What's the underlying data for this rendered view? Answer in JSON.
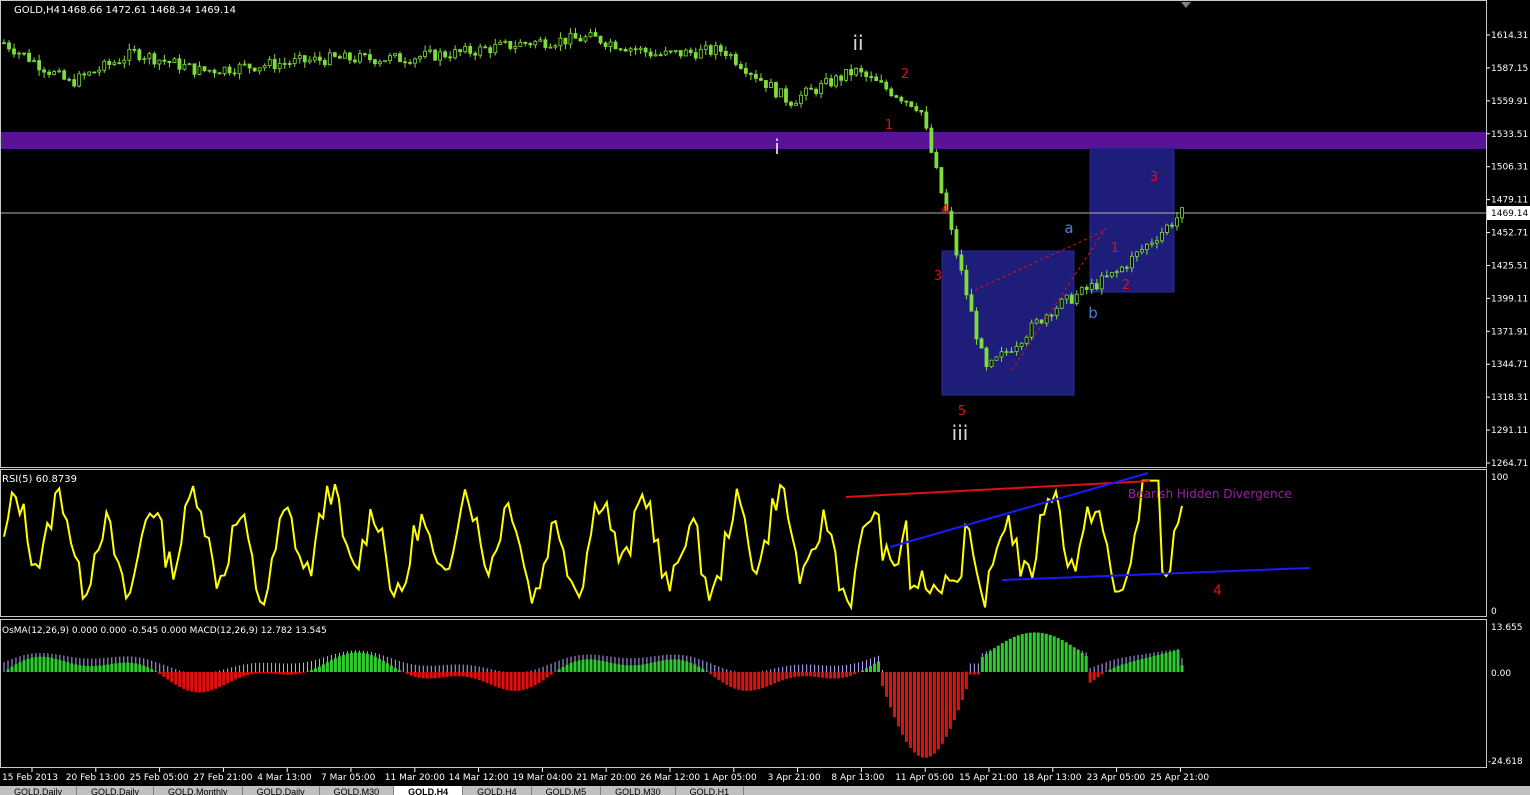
{
  "window": {
    "symbol_header": "GOLD,H4",
    "ohlc_header": "1468.66 1472.61 1468.34 1469.14"
  },
  "colors": {
    "background": "#000000",
    "candle": "#7fdc3c",
    "resistance_band": "#5a1296",
    "box": "#1e1e7a",
    "rsi_line": "#ffff00",
    "hist_up_bright": "#2ecc2e",
    "hist_down_bright": "#e01010",
    "macd_signal": "#b8a8ff",
    "wave_red": "#e01010",
    "wave_blue": "#4f7fdc",
    "divergence_text": "#9b1fa8"
  },
  "price_axis": {
    "ticks": [
      "1614.31",
      "1587.15",
      "1559.91",
      "1533.51",
      "1506.31",
      "1479.11",
      "1452.71",
      "1425.51",
      "1399.11",
      "1371.91",
      "1344.71",
      "1318.31",
      "1291.11",
      "1264.71"
    ],
    "current_price": "1469.14",
    "range": [
      1257,
      1630
    ]
  },
  "time_axis": {
    "labels": [
      "15 Feb 2013",
      "20 Feb 13:00",
      "25 Feb 05:00",
      "27 Feb 21:00",
      "4 Mar 13:00",
      "7 Mar 05:00",
      "11 Mar 20:00",
      "14 Mar 12:00",
      "19 Mar 04:00",
      "21 Mar 20:00",
      "26 Mar 12:00",
      "1 Apr 05:00",
      "3 Apr 21:00",
      "8 Apr 13:00",
      "11 Apr 05:00",
      "15 Apr 21:00",
      "18 Apr 13:00",
      "23 Apr 05:00",
      "25 Apr 21:00"
    ]
  },
  "wave_labels": [
    {
      "text": "ii",
      "color": "white"
    },
    {
      "text": "i",
      "color": "white"
    },
    {
      "text": "iii",
      "color": "white"
    },
    {
      "text": "2",
      "color": "red"
    },
    {
      "text": "1",
      "color": "red"
    },
    {
      "text": "4",
      "color": "red"
    },
    {
      "text": "3",
      "color": "red"
    },
    {
      "text": "5",
      "color": "red"
    },
    {
      "text": "a",
      "color": "blue"
    },
    {
      "text": "b",
      "color": "blue"
    },
    {
      "text": "1",
      "color": "red"
    },
    {
      "text": "2",
      "color": "red"
    },
    {
      "text": "3",
      "color": "red"
    }
  ],
  "rsi": {
    "header": "RSI(5) 60.8739",
    "axis_top": "100",
    "axis_bottom": "0",
    "annotation": "Bearish Hidden Divergence",
    "wave_label": "4"
  },
  "macd": {
    "header": "OsMA(12,26,9) 0.000 0.000 -0.545 0.000  MACD(12,26,9) 12.782 13.545",
    "axis_top": "13.655",
    "axis_zero": "0.00",
    "axis_bottom": "-24.618"
  },
  "tabs": [
    "GOLD,Daily",
    "GOLD,Daily",
    "GOLD,Monthly",
    "GOLD,Daily",
    "GOLD,M30",
    "GOLD,H4",
    "GOLD,H4",
    "GOLD,M5",
    "GOLD,M30",
    "GOLD,H1"
  ],
  "active_tab": 5,
  "chart_data": [
    {
      "type": "candlestick",
      "title": "GOLD,H4",
      "x": [
        "15 Feb 2013",
        "20 Feb 13:00",
        "25 Feb 05:00",
        "27 Feb 21:00",
        "4 Mar 13:00",
        "7 Mar 05:00",
        "11 Mar 20:00",
        "14 Mar 12:00",
        "19 Mar 04:00",
        "21 Mar 20:00",
        "26 Mar 12:00",
        "1 Apr 05:00",
        "3 Apr 21:00",
        "8 Apr 13:00",
        "11 Apr 05:00",
        "15 Apr 21:00",
        "18 Apr 13:00",
        "23 Apr 05:00",
        "25 Apr 21:00"
      ],
      "close_approx": [
        1608,
        1575,
        1600,
        1585,
        1590,
        1595,
        1595,
        1600,
        1608,
        1612,
        1598,
        1602,
        1560,
        1585,
        1555,
        1340,
        1390,
        1420,
        1469
      ],
      "ylim": [
        1257,
        1630
      ],
      "resistance_zone": [
        1522,
        1540
      ]
    },
    {
      "type": "line",
      "title": "RSI(5) 60.8739",
      "ylim": [
        0,
        100
      ],
      "current": 60.8739
    },
    {
      "type": "bar",
      "title": "OsMA(12,26,9) 0.000 0.000 -0.545 0.000  MACD(12,26,9) 12.782 13.545",
      "ylim": [
        -24.618,
        13.655
      ]
    }
  ]
}
